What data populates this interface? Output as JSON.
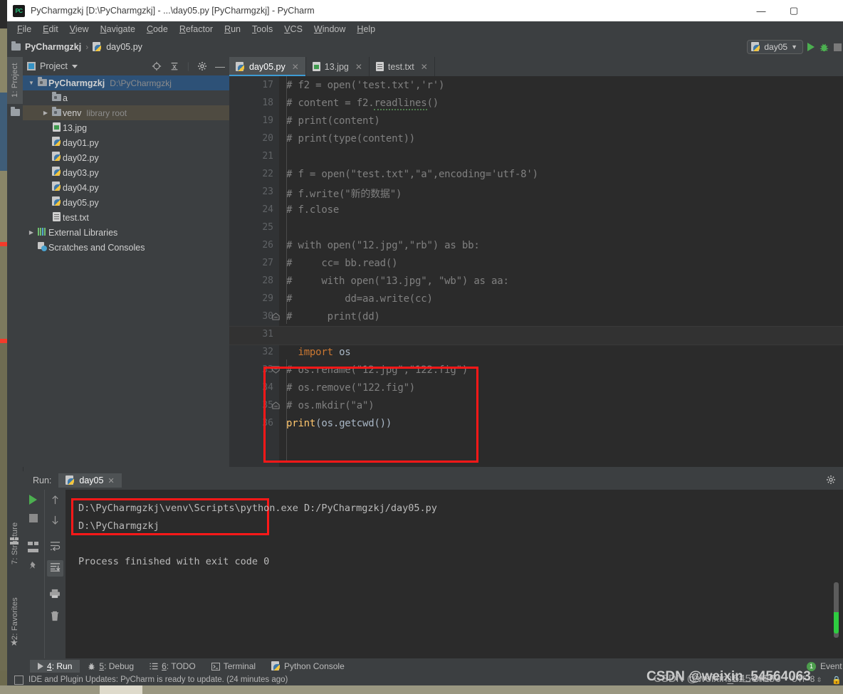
{
  "window": {
    "title": "PyCharmgzkj [D:\\PyCharmgzkj] - ...\\day05.py [PyCharmgzkj] - PyCharm",
    "app_icon_text": "PC",
    "minimize": "—",
    "maximize": "▢",
    "close": "✕"
  },
  "menu": [
    {
      "label": "File"
    },
    {
      "label": "Edit"
    },
    {
      "label": "View"
    },
    {
      "label": "Navigate"
    },
    {
      "label": "Code"
    },
    {
      "label": "Refactor"
    },
    {
      "label": "Run"
    },
    {
      "label": "Tools"
    },
    {
      "label": "VCS"
    },
    {
      "label": "Window"
    },
    {
      "label": "Help"
    }
  ],
  "breadcrumb": {
    "project": "PyCharmgzkj",
    "separator": "›",
    "file": "day05.py"
  },
  "run_config": {
    "name": "day05",
    "dropdown_arrow": "▼",
    "run_tooltip": "Run",
    "debug_tooltip": "Debug",
    "stop_tooltip": "Stop"
  },
  "toolstrip": {
    "project": "1: Project",
    "structure": "7: Structure",
    "favorites": "2: Favorites"
  },
  "project_panel": {
    "title": "Project",
    "tree": [
      {
        "indent": 0,
        "arrow": "▼",
        "icon": "folder-icon",
        "label": "PyCharmgzkj",
        "hint": "D:\\PyCharmgzkj",
        "state": "selected-blue",
        "bold": true
      },
      {
        "indent": 1,
        "arrow": "",
        "icon": "folder-icon",
        "label": "a",
        "hint": "",
        "state": "normal",
        "bold": false
      },
      {
        "indent": 1,
        "arrow": "▶",
        "icon": "folder-icon",
        "label": "venv",
        "hint": "library root",
        "state": "selected-tan",
        "bold": false
      },
      {
        "indent": 1,
        "arrow": "",
        "icon": "image-icon",
        "label": "13.jpg",
        "hint": "",
        "state": "normal",
        "bold": false
      },
      {
        "indent": 1,
        "arrow": "",
        "icon": "python-icon",
        "label": "day01.py",
        "hint": "",
        "state": "normal",
        "bold": false
      },
      {
        "indent": 1,
        "arrow": "",
        "icon": "python-icon",
        "label": "day02.py",
        "hint": "",
        "state": "normal",
        "bold": false
      },
      {
        "indent": 1,
        "arrow": "",
        "icon": "python-icon",
        "label": "day03.py",
        "hint": "",
        "state": "normal",
        "bold": false
      },
      {
        "indent": 1,
        "arrow": "",
        "icon": "python-icon",
        "label": "day04.py",
        "hint": "",
        "state": "normal",
        "bold": false
      },
      {
        "indent": 1,
        "arrow": "",
        "icon": "python-icon",
        "label": "day05.py",
        "hint": "",
        "state": "normal",
        "bold": false
      },
      {
        "indent": 1,
        "arrow": "",
        "icon": "text-icon",
        "label": "test.txt",
        "hint": "",
        "state": "normal",
        "bold": false
      },
      {
        "indent": 0,
        "arrow": "▶",
        "icon": "library-icon",
        "label": "External Libraries",
        "hint": "",
        "state": "normal",
        "bold": false
      },
      {
        "indent": 0,
        "arrow": "",
        "icon": "scratch-icon",
        "label": "Scratches and Consoles",
        "hint": "",
        "state": "normal",
        "bold": false
      }
    ]
  },
  "editor": {
    "tabs": [
      {
        "label": "day05.py",
        "icon": "python-icon",
        "active": true,
        "close": "✕"
      },
      {
        "label": "13.jpg",
        "icon": "image-icon",
        "active": false,
        "close": "✕"
      },
      {
        "label": "test.txt",
        "icon": "text-icon",
        "active": false,
        "close": "✕"
      }
    ],
    "first_line_number": 17,
    "lines": [
      {
        "n": 17,
        "segs": [
          {
            "t": "# f2 = open('test.txt','r')",
            "c": "com"
          }
        ]
      },
      {
        "n": 18,
        "segs": [
          {
            "t": "# content = f2.",
            "c": "com"
          },
          {
            "t": "readlines",
            "c": "com-squig"
          },
          {
            "t": "()",
            "c": "com"
          }
        ]
      },
      {
        "n": 19,
        "segs": [
          {
            "t": "# print(content)",
            "c": "com"
          }
        ]
      },
      {
        "n": 20,
        "segs": [
          {
            "t": "# print(type(content))",
            "c": "com"
          }
        ]
      },
      {
        "n": 21,
        "segs": []
      },
      {
        "n": 22,
        "segs": [
          {
            "t": "# f = open(\"test.txt\",\"a\",encoding='utf-8')",
            "c": "com"
          }
        ]
      },
      {
        "n": 23,
        "segs": [
          {
            "t": "# f.write(\"新的数据\")",
            "c": "com"
          }
        ]
      },
      {
        "n": 24,
        "segs": [
          {
            "t": "# f.close",
            "c": "com"
          }
        ]
      },
      {
        "n": 25,
        "segs": []
      },
      {
        "n": 26,
        "segs": [
          {
            "t": "# with open(\"12.jpg\",\"rb\") as bb:",
            "c": "com"
          }
        ]
      },
      {
        "n": 27,
        "segs": [
          {
            "t": "#     cc= bb.read()",
            "c": "com"
          }
        ]
      },
      {
        "n": 28,
        "segs": [
          {
            "t": "#     with open(\"13.jpg\", \"wb\") as aa:",
            "c": "com"
          }
        ]
      },
      {
        "n": 29,
        "segs": [
          {
            "t": "#         dd=aa.write(cc)",
            "c": "com"
          }
        ]
      },
      {
        "n": 30,
        "segs": [
          {
            "t": "#      print(dd)",
            "c": "com"
          }
        ],
        "fold": "end"
      },
      {
        "n": 31,
        "segs": [],
        "current": true
      },
      {
        "n": 32,
        "segs": [
          {
            "t": "  ",
            "c": "txt"
          },
          {
            "t": "import",
            "c": "kw"
          },
          {
            "t": " os",
            "c": "txt"
          }
        ]
      },
      {
        "n": 33,
        "segs": [
          {
            "t": "# os.rename(\"12.jpg\",\"122.fig\")",
            "c": "com"
          }
        ],
        "fold": "start"
      },
      {
        "n": 34,
        "segs": [
          {
            "t": "# os.remove(\"122.fig\")",
            "c": "com"
          }
        ]
      },
      {
        "n": 35,
        "segs": [
          {
            "t": "# os.mkdir(\"a\")",
            "c": "com"
          }
        ],
        "fold": "end"
      },
      {
        "n": 36,
        "segs": [
          {
            "t": "print",
            "c": "fn"
          },
          {
            "t": "(os.getcwd())",
            "c": "txt"
          }
        ]
      }
    ]
  },
  "run_window": {
    "label": "Run:",
    "tab": "day05",
    "tab_close": "✕",
    "console_lines": [
      "D:\\PyCharmgzkj\\venv\\Scripts\\python.exe D:/PyCharmgzkj/day05.py",
      "D:\\PyCharmgzkj",
      "",
      "Process finished with exit code 0"
    ],
    "toolbar_icons": [
      "rerun-icon",
      "stop-icon",
      "layout-icon",
      "pin-icon",
      "up-arrow-icon",
      "down-arrow-icon",
      "soft-wrap-icon",
      "scroll-to-end-icon",
      "print-icon",
      "trash-icon"
    ]
  },
  "bottom_bar": {
    "items": [
      {
        "label": "4: Run",
        "underline": "4",
        "icon": "run-triangle-icon",
        "selected": true
      },
      {
        "label": "5: Debug",
        "underline": "5",
        "icon": "bug-icon",
        "selected": false
      },
      {
        "label": "6: TODO",
        "underline": "6",
        "icon": "todo-list-icon",
        "selected": false
      },
      {
        "label": "Terminal",
        "underline": "",
        "icon": "terminal-icon",
        "selected": false
      },
      {
        "label": "Python Console",
        "underline": "",
        "icon": "python-icon",
        "selected": false
      }
    ],
    "event_log": "Event Log",
    "event_count": "1"
  },
  "status_bar": {
    "update_message": "IDE and Plugin Updates: PyCharm is ready to update. (24 minutes ago)",
    "caret_position": "31:1",
    "line_separator": "CRLF",
    "encoding": "UTF-8",
    "lock_icon": "🔒",
    "sep_arrows": "⇕"
  },
  "watermark": {
    "line1": "CSDN @weixin_54564063",
    "line2": "CSDN @weixin_54564063"
  },
  "colors": {
    "accent_blue": "#3d9bd4",
    "selection_blue": "#2d5177",
    "editor_bg": "#2b2b2b",
    "panel_bg": "#3c3f41",
    "red_box": "#ff1818",
    "comment": "#808080",
    "keyword": "#cc7832",
    "function": "#ffc66d",
    "green_run": "#4caf50"
  }
}
